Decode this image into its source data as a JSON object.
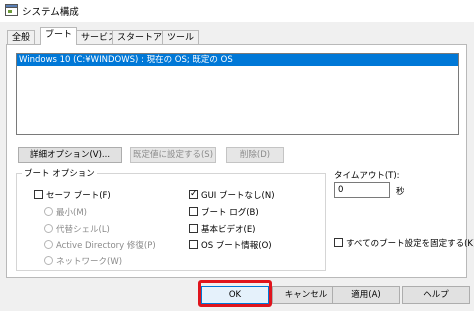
{
  "window": {
    "title": "システム構成",
    "icon": "msconfig-icon"
  },
  "tabs": [
    {
      "label": "全般",
      "active": false
    },
    {
      "label": "ブート",
      "active": true
    },
    {
      "label": "サービス",
      "active": false
    },
    {
      "label": "スタートアップ",
      "active": false
    },
    {
      "label": "ツール",
      "active": false
    }
  ],
  "boot_list": {
    "selected_entry": "Windows 10 (C:¥WINDOWS) : 現在の OS; 既定の OS"
  },
  "actions": {
    "advanced": "詳細オプション(V)...",
    "set_default": "既定値に設定する(S)",
    "delete": "削除(D)"
  },
  "boot_options": {
    "group_label": "ブート オプション",
    "safe_boot": {
      "label": "セーフ ブート(F)",
      "checked": false
    },
    "safe_modes": [
      {
        "label": "最小(M)"
      },
      {
        "label": "代替シェル(L)"
      },
      {
        "label": "Active Directory 修復(P)"
      },
      {
        "label": "ネットワーク(W)"
      }
    ],
    "no_gui_boot": {
      "label": "GUI ブートなし(N)",
      "checked": true
    },
    "boot_log": {
      "label": "ブート ログ(B)",
      "checked": false
    },
    "base_video": {
      "label": "基本ビデオ(E)",
      "checked": false
    },
    "os_boot_info": {
      "label": "OS ブート情報(O)",
      "checked": false
    }
  },
  "timeout": {
    "label": "タイムアウト(T):",
    "value": "0",
    "unit": "秒"
  },
  "make_permanent": {
    "label": "すべてのブート設定を固定する(K)",
    "checked": false
  },
  "dialog_buttons": {
    "ok": "OK",
    "cancel": "キャンセル",
    "apply": "適用(A)",
    "help": "ヘルプ"
  },
  "colors": {
    "selection": "#0078d7",
    "highlight_box": "#e0141c"
  }
}
